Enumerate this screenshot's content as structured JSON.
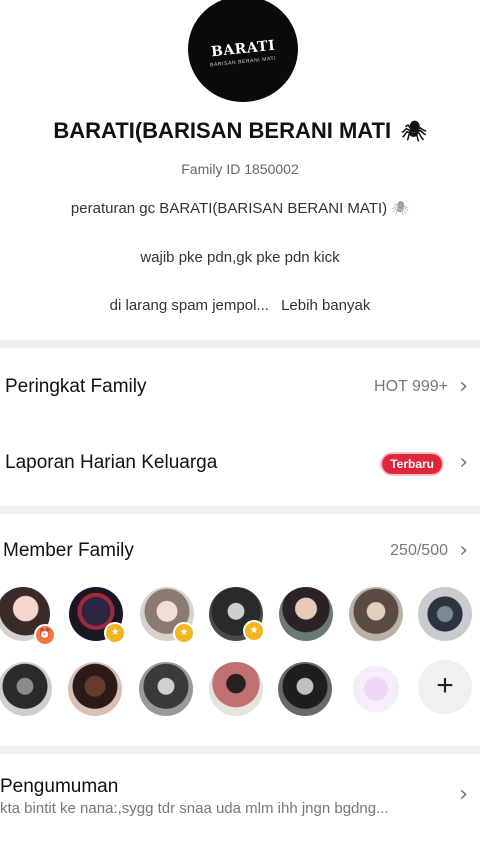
{
  "group": {
    "logo_text": "BARATI",
    "logo_subtitle": "BARISAN BERANI MATI",
    "title": "BARATI(BARISAN BERANI MATI",
    "family_id": "Family ID 1850002",
    "desc_line1": "peraturan gc BARATI(BARISAN BERANI MATI)",
    "desc_line2": "wajib pke pdn,gk pke pdn kick",
    "desc_line3": "di larang spam jempol...",
    "more_label": "Lebih banyak"
  },
  "rows": {
    "ranking_label": "Peringkat Family",
    "ranking_value": "HOT 999+",
    "report_label": "Laporan Harian Keluarga",
    "report_badge": "Terbaru"
  },
  "members": {
    "label": "Member Family",
    "count": "250/500",
    "add_label": "+"
  },
  "announcement": {
    "title": "Pengumuman",
    "text": "kta bintit ke nana:,sygg tdr snaa uda mlm ihh jngn bgdng..."
  },
  "icons": {
    "spider": "spider-icon",
    "chevron": "chevron-right-icon",
    "add": "plus-icon"
  },
  "colors": {
    "badge": "#e0263a",
    "background": "#f1f1f1",
    "card": "#ffffff"
  }
}
